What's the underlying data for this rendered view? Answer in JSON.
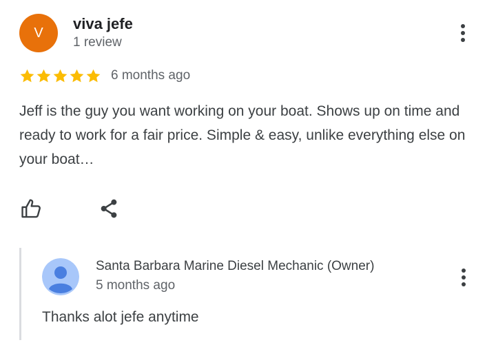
{
  "review": {
    "avatar_initial": "V",
    "avatar_color": "#e8710a",
    "reviewer_name": "viva jefe",
    "reviewer_meta": "1 review",
    "rating": 5,
    "rating_max": 5,
    "star_color": "#fbbc04",
    "date": "6 months ago",
    "text": "Jeff is the guy you want working on your boat. Shows up on time and ready to work for a fair price. Simple & easy, unlike everything else on your boat…",
    "actions": [
      {
        "icon": "thumbs-up-icon"
      },
      {
        "icon": "share-icon"
      }
    ],
    "menu_icon": "more-vert-icon"
  },
  "owner_reply": {
    "name": "Santa Barbara Marine Diesel Mechanic (Owner)",
    "date": "5 months ago",
    "text": "Thanks alot jefe anytime",
    "avatar_icon": "default-user-avatar-icon",
    "avatar_color": "#a8c7fa",
    "menu_icon": "more-vert-icon"
  }
}
